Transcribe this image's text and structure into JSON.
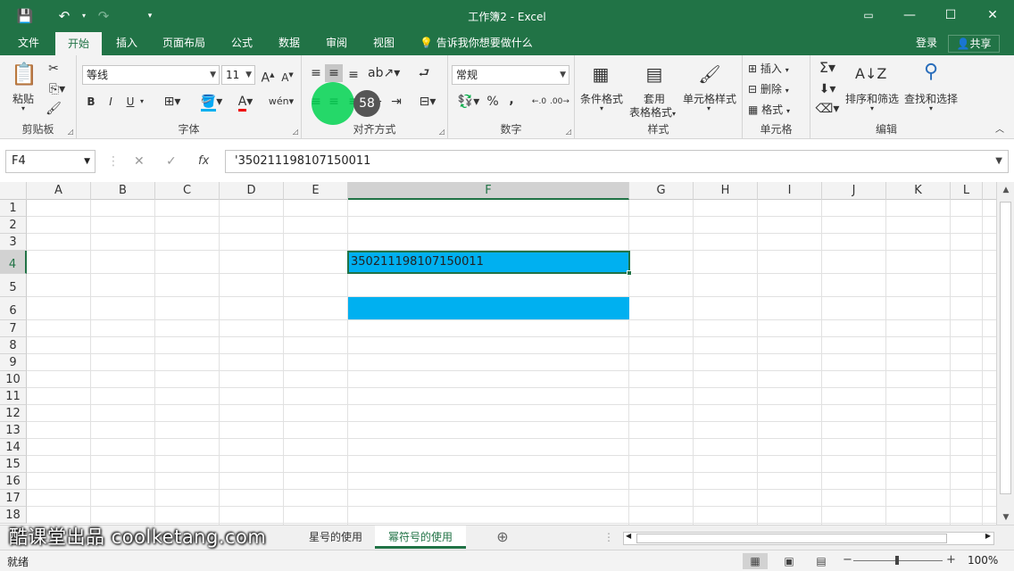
{
  "window": {
    "title": "工作簿2 - Excel",
    "qat": {
      "save_icon": "save-icon",
      "undo_icon": "undo-icon",
      "redo_icon": "redo-icon",
      "customize_icon": "chevron-down-icon"
    },
    "controls": {
      "ribbon_display": "▭",
      "minimize": "—",
      "maximize": "☐",
      "close": "✕"
    }
  },
  "tabs": [
    {
      "label": "文件",
      "active": false
    },
    {
      "label": "开始",
      "active": true
    },
    {
      "label": "插入",
      "active": false
    },
    {
      "label": "页面布局",
      "active": false
    },
    {
      "label": "公式",
      "active": false
    },
    {
      "label": "数据",
      "active": false
    },
    {
      "label": "审阅",
      "active": false
    },
    {
      "label": "视图",
      "active": false
    }
  ],
  "tell_me": "告诉我你想要做什么",
  "login": "登录",
  "share": "共享",
  "ribbon": {
    "clipboard": {
      "label": "剪贴板",
      "paste": "粘贴"
    },
    "font": {
      "label": "字体",
      "font_name": "等线",
      "font_size": "11",
      "bold": "B",
      "italic": "I",
      "underline": "U"
    },
    "alignment": {
      "label": "对齐方式"
    },
    "number": {
      "label": "数字",
      "format": "常规",
      "percent": "%",
      "comma": ","
    },
    "styles": {
      "label": "样式",
      "conditional": "条件格式",
      "table_format_1": "套用",
      "table_format_2": "表格格式",
      "cell_styles": "单元格样式"
    },
    "cells": {
      "label": "单元格",
      "insert": "插入",
      "delete": "删除",
      "format": "格式"
    },
    "editing": {
      "label": "编辑",
      "sort_filter": "排序和筛选",
      "find_select": "查找和选择"
    }
  },
  "formula_bar": {
    "name_box": "F4",
    "fx": "fx",
    "content": "'350211198107150011"
  },
  "grid": {
    "columns": [
      "A",
      "B",
      "C",
      "D",
      "E",
      "F",
      "G",
      "H",
      "I",
      "J",
      "K",
      "L"
    ],
    "rows": [
      "1",
      "2",
      "3",
      "4",
      "5",
      "6",
      "7",
      "8",
      "9",
      "10",
      "11",
      "12",
      "13",
      "14",
      "15",
      "16",
      "17",
      "18"
    ],
    "selected_column": "F",
    "selected_row": "4",
    "fill_color": "#00b0f0",
    "cell_F4": "350211198107150011"
  },
  "sheets": [
    {
      "label": "星号的使用",
      "active": false
    },
    {
      "label": "幂符号的使用",
      "active": true
    }
  ],
  "add_sheet": "⊕",
  "watermark": "酷课堂出品 coolketang.com",
  "status": {
    "ready": "就绪",
    "zoom": "100%",
    "zoom_minus": "−",
    "zoom_plus": "+"
  },
  "click_indicator": {
    "step": "58"
  },
  "accent_color": "#217346"
}
